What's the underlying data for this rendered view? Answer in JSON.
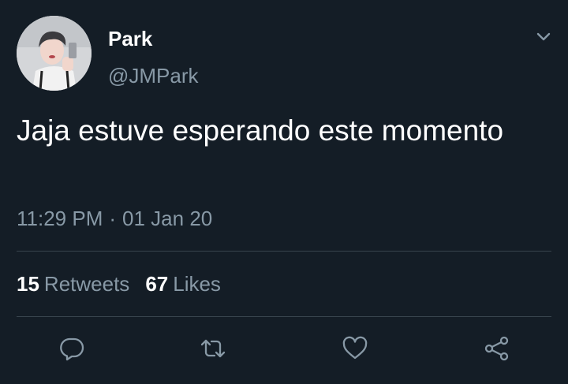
{
  "user": {
    "display_name": "Park",
    "handle": "@JMPark"
  },
  "tweet": {
    "text": "Jaja estuve esperando este momento",
    "time": "11:29 PM",
    "separator": "·",
    "date": "01 Jan 20"
  },
  "stats": {
    "retweets_count": "15",
    "retweets_label": "Retweets",
    "likes_count": "67",
    "likes_label": "Likes"
  },
  "actions": [
    "reply-icon",
    "retweet-icon",
    "like-icon",
    "share-icon"
  ],
  "colors": {
    "background": "#141d26",
    "secondary_text": "#8899a6",
    "divider": "#38444d",
    "icon": "#8899a6"
  }
}
